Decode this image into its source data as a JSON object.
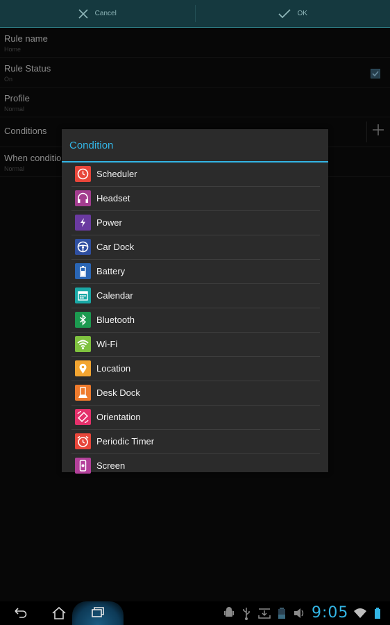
{
  "action_bar": {
    "cancel_label": "Cancel",
    "ok_label": "OK"
  },
  "rows": [
    {
      "title": "Rule name",
      "value": "Home"
    },
    {
      "title": "Rule Status",
      "value": "On",
      "checked": true
    },
    {
      "title": "Profile",
      "value": "Normal"
    },
    {
      "title": "Conditions"
    },
    {
      "title": "When conditions",
      "value": "Normal"
    }
  ],
  "dialog": {
    "title": "Condition",
    "items": [
      {
        "label": "Scheduler",
        "icon": "clock-icon",
        "color": "#e8463a"
      },
      {
        "label": "Headset",
        "icon": "headset-icon",
        "color": "#a33d8f"
      },
      {
        "label": "Power",
        "icon": "power-plug-icon",
        "color": "#6a3aa0"
      },
      {
        "label": "Car Dock",
        "icon": "steering-wheel-icon",
        "color": "#2f4fa0"
      },
      {
        "label": "Battery",
        "icon": "battery-icon",
        "color": "#2a66b5"
      },
      {
        "label": "Calendar",
        "icon": "calendar-icon",
        "color": "#1aa8a6"
      },
      {
        "label": "Bluetooth",
        "icon": "bluetooth-icon",
        "color": "#1c9a50"
      },
      {
        "label": "Wi-Fi",
        "icon": "wifi-icon",
        "color": "#7fc23f"
      },
      {
        "label": "Location",
        "icon": "location-pin-icon",
        "color": "#f3a531"
      },
      {
        "label": "Desk Dock",
        "icon": "desk-dock-icon",
        "color": "#ef7b2d"
      },
      {
        "label": "Orientation",
        "icon": "orientation-icon",
        "color": "#e4306b"
      },
      {
        "label": "Periodic Timer",
        "icon": "alarm-clock-icon",
        "color": "#e8463a"
      },
      {
        "label": "Screen",
        "icon": "phone-screen-icon",
        "color": "#b3409a"
      }
    ]
  },
  "status_bar": {
    "time": "9:05"
  }
}
